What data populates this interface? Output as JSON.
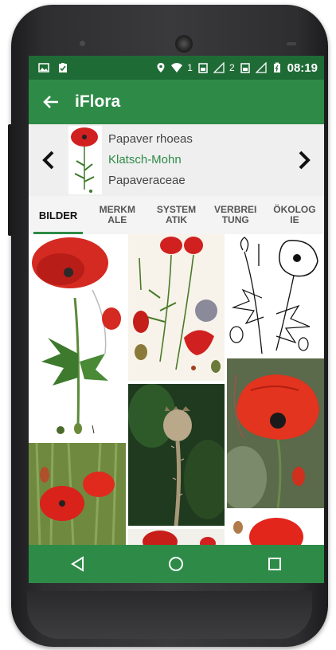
{
  "status_bar": {
    "time": "08:19",
    "sim1": "1",
    "sim2": "2",
    "icons": [
      "image-icon",
      "clipboard-check-icon",
      "location-icon",
      "wifi-icon",
      "signal-icon",
      "battery-icon"
    ]
  },
  "app_bar": {
    "title": "iFlora",
    "back_icon": "arrow-left-icon"
  },
  "species": {
    "latin_name": "Papaver rhoeas",
    "common_name": "Klatsch-Mohn",
    "family": "Papaveraceae"
  },
  "tabs": [
    {
      "label": "BILDER",
      "active": true
    },
    {
      "label": "MERKM\nALE",
      "active": false
    },
    {
      "label": "SYSTEM\nATIK",
      "active": false
    },
    {
      "label": "VERBREI\nTUNG",
      "active": false
    },
    {
      "label": "ÖKOLOG\nIE",
      "active": false
    }
  ],
  "gallery_images": [
    "poppy-botanical-illustration",
    "poppy-botanical-plate",
    "poppy-line-drawing",
    "poppy-seed-capsule-photo",
    "red-poppy-flower-photo",
    "poppies-in-grass-photo",
    "poppy-flower-partial",
    "poppy-flower-partial-right"
  ],
  "colors": {
    "primary": "#2e8b47",
    "primary_dark": "#1f6b36",
    "poppy_red": "#d0201f"
  },
  "nav_bar": [
    "back-triangle-icon",
    "home-circle-icon",
    "recents-square-icon"
  ]
}
